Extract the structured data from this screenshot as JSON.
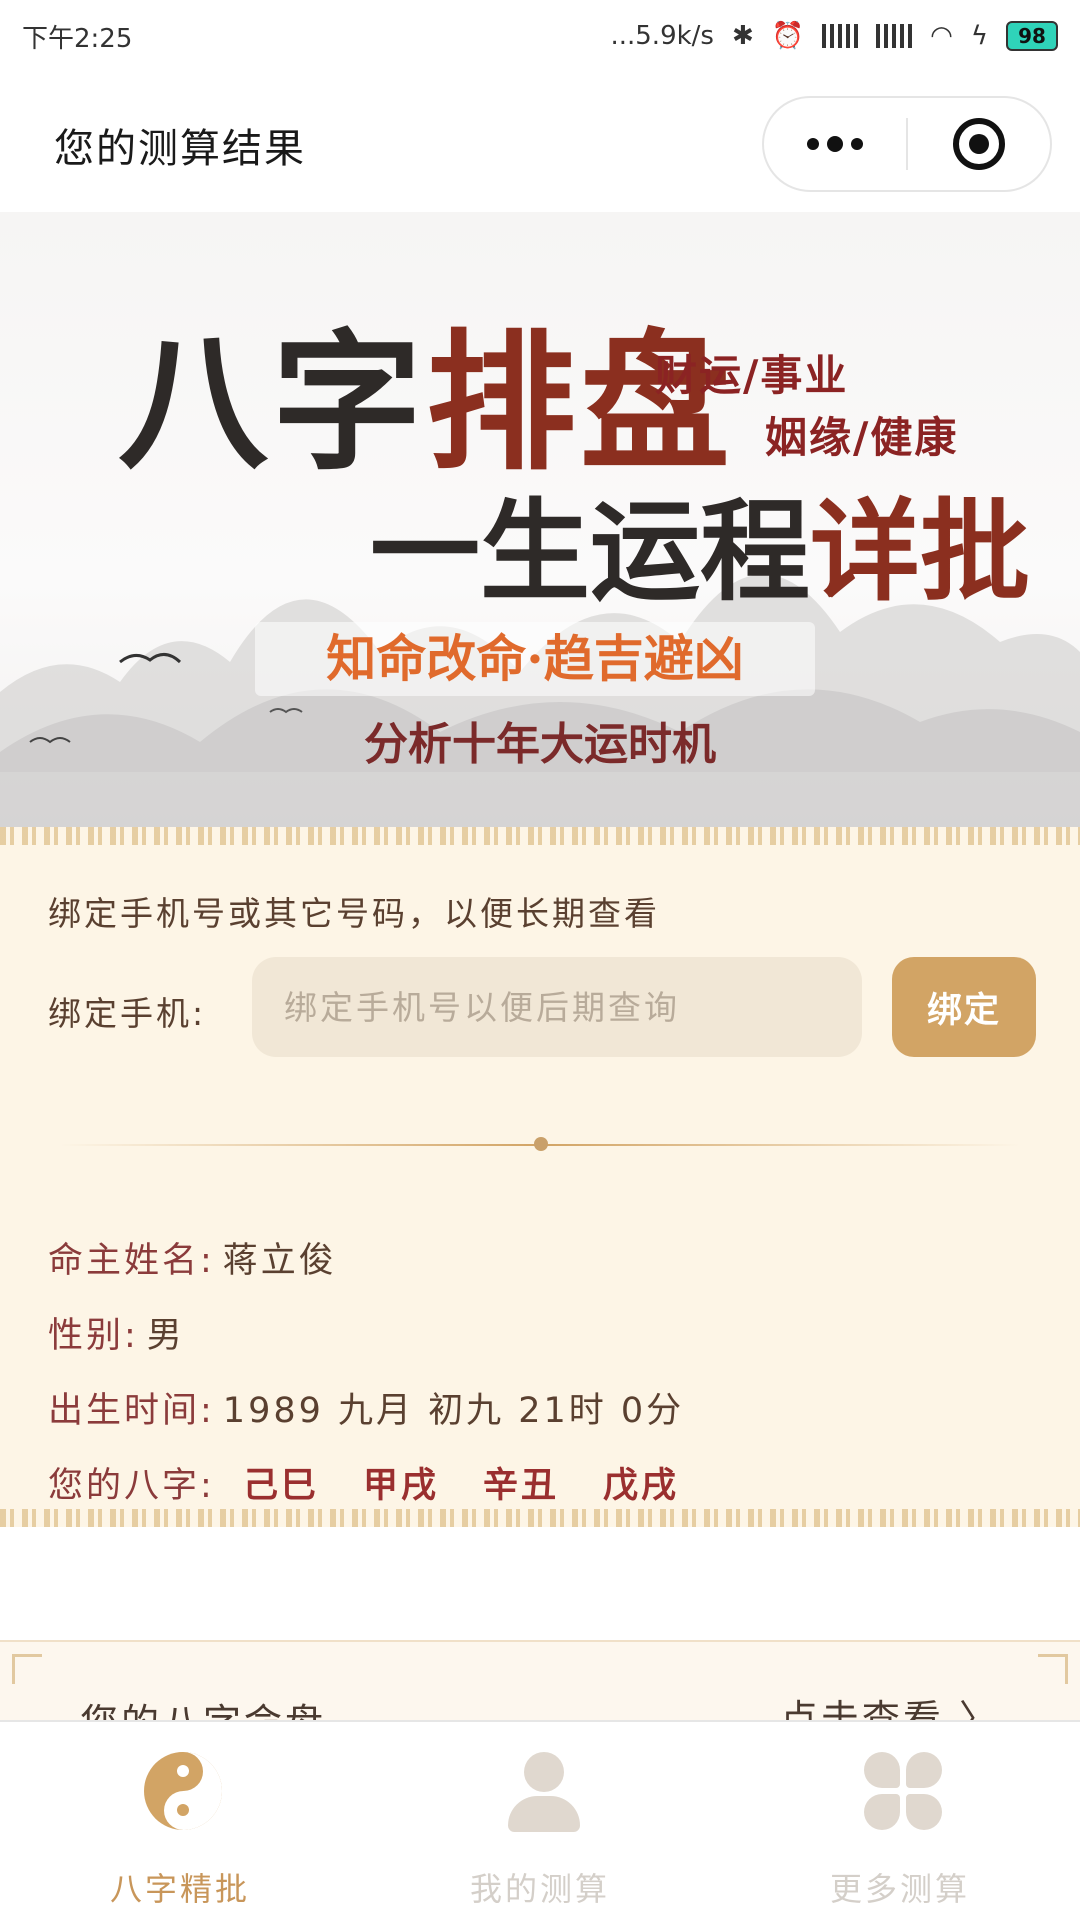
{
  "status_bar": {
    "time": "下午2:25",
    "network_speed": "...5.9k/s",
    "battery": "98"
  },
  "nav": {
    "title": "您的测算结果"
  },
  "banner": {
    "title_part1": "八字",
    "title_part2": "排盘",
    "subtitle_part1": "一生运程",
    "subtitle_part2": "详批",
    "tag1": "财运/事业",
    "tag2": "姻缘/健康",
    "slogan": "知命改命·趋吉避凶",
    "slogan2": "分析十年大运时机"
  },
  "bind": {
    "intro": "绑定手机号或其它号码，以便长期查看",
    "label": "绑定手机:",
    "placeholder": "绑定手机号以便后期查询",
    "button": "绑定"
  },
  "profile": {
    "name_label": "命主姓名:",
    "name_value": "蒋立俊",
    "gender_label": "性别:",
    "gender_value": "男",
    "birth_label": "出生时间:",
    "birth_value": "1989 九月 初九 21时 0分",
    "bazi_label": "您的八字:",
    "bazi": [
      "己巳",
      "甲戌",
      "辛丑",
      "戊戌"
    ]
  },
  "next_section": {
    "title": "您的八字命盘",
    "link": "点击查看 〉"
  },
  "tabs": [
    {
      "label": "八字精批",
      "icon": "yin-yang-icon",
      "active": true
    },
    {
      "label": "我的测算",
      "icon": "person-icon",
      "active": false
    },
    {
      "label": "更多测算",
      "icon": "grid-icon",
      "active": false
    }
  ],
  "colors": {
    "accent": "#d2a465",
    "card_bg": "#fdf5e6",
    "text_red": "#8b3b3b"
  }
}
